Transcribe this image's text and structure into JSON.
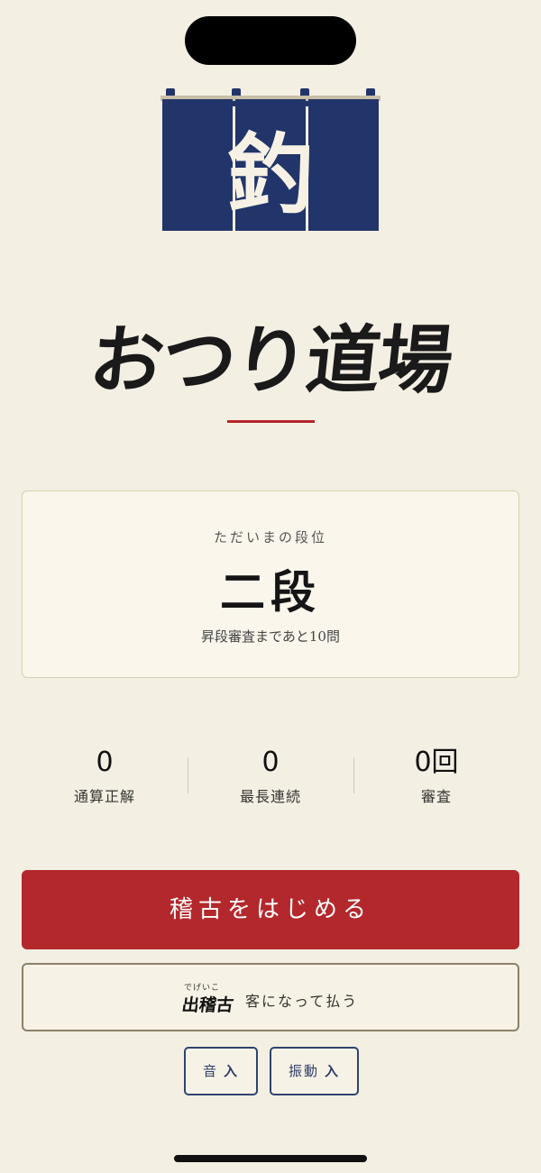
{
  "header": {
    "noren_kanji": "釣",
    "app_title": "おつり道場"
  },
  "rank": {
    "label": "ただいまの段位",
    "value": "二段",
    "subtext": "昇段審査まであと10問"
  },
  "stats": [
    {
      "value": "0",
      "label": "通算正解"
    },
    {
      "value": "0",
      "label": "最長連続"
    },
    {
      "value": "0回",
      "label": "審査"
    }
  ],
  "actions": {
    "start_label": "稽古をはじめる",
    "dekeiko_ruby": "でげいこ",
    "dekeiko_label": "出稽古",
    "dekeiko_desc": "客になって払う"
  },
  "toggles": {
    "sound_label": "音",
    "sound_state": "入",
    "vibration_label": "振動",
    "vibration_state": "入"
  },
  "colors": {
    "background": "#f4efe3",
    "accent_red": "#b3282c",
    "noren_navy": "#22356a",
    "toggle_border": "#2e4470"
  },
  "icons": {
    "noren": "noren-curtain-icon"
  }
}
